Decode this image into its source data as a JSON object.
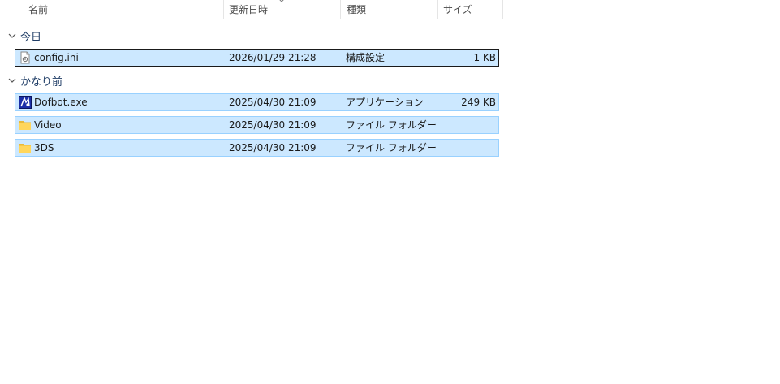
{
  "columns": {
    "name": "名前",
    "modified": "更新日時",
    "type": "種類",
    "size": "サイズ"
  },
  "groups": [
    {
      "label": "今日",
      "items": [
        {
          "name": "config.ini",
          "date": "2026/01/29 21:28",
          "type": "構成設定",
          "size": "1 KB",
          "icon": "ini-file-icon"
        }
      ]
    },
    {
      "label": "かなり前",
      "items": [
        {
          "name": "Dofbot.exe",
          "date": "2025/04/30 21:09",
          "type": "アプリケーション",
          "size": "249 KB",
          "icon": "exe-app-icon"
        },
        {
          "name": "Video",
          "date": "2025/04/30 21:09",
          "type": "ファイル フォルダー",
          "size": "",
          "icon": "folder-icon"
        },
        {
          "name": "3DS",
          "date": "2025/04/30 21:09",
          "type": "ファイル フォルダー",
          "size": "",
          "icon": "folder-icon"
        }
      ]
    }
  ],
  "colors": {
    "selection_bg": "#cce8ff",
    "selection_border": "#99d1ff",
    "folder": "#ffd65c",
    "group_text": "#1f3d66"
  }
}
